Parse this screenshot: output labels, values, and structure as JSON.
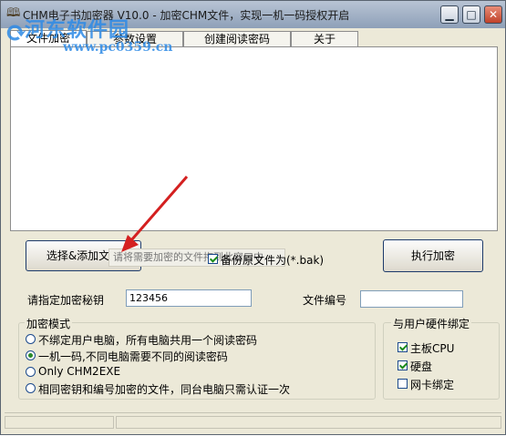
{
  "window": {
    "title": "CHM电子书加密器 V10.0 - 加密CHM文件，实现一机一码授权开启",
    "app_icon": "book-icon",
    "minimize_icon": "minimize-icon",
    "maximize_icon": "maximize-icon",
    "close_icon": "close-icon"
  },
  "tabs": [
    {
      "label": "文件加密",
      "active": true
    },
    {
      "label": "参数设置",
      "active": false
    },
    {
      "label": "创建阅读密码",
      "active": false
    },
    {
      "label": "关于",
      "active": false
    }
  ],
  "file_list": {
    "items": []
  },
  "actions": {
    "select_files_label": "选择&添加文件",
    "drop_hint": "请将需要加密的文件拖到此窗口中",
    "backup_label": "备份原文件为(*.bak)",
    "backup_checked": true,
    "encrypt_label": "执行加密"
  },
  "fields": {
    "key_label": "请指定加密秘钥",
    "key_value": "123456",
    "file_number_label": "文件编号",
    "file_number_value": ""
  },
  "encrypt_mode": {
    "title": "加密模式",
    "options": [
      {
        "label": "不绑定用户电脑，所有电脑共用一个阅读密码",
        "checked": false
      },
      {
        "label": "一机一码,不同电脑需要不同的阅读密码",
        "checked": true
      },
      {
        "label": "Only CHM2EXE",
        "checked": false
      },
      {
        "label": "相同密钥和编号加密的文件，同台电脑只需认证一次",
        "checked": false
      }
    ]
  },
  "hardware_binding": {
    "title": "与用户硬件绑定",
    "options": [
      {
        "label": "主板CPU",
        "checked": true
      },
      {
        "label": "硬盘",
        "checked": true
      },
      {
        "label": "网卡绑定",
        "checked": false
      }
    ]
  },
  "watermark": {
    "site_name": "河东软件园",
    "url": "www.pc0359.cn"
  },
  "colors": {
    "accent_arrow": "#d42020",
    "watermark": "#2d8ae6",
    "titlebar": "#9fb0c6"
  }
}
